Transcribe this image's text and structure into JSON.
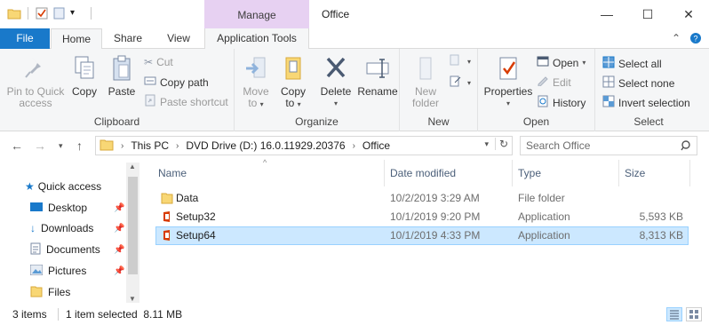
{
  "titlebar": {
    "manage_tab": "Manage",
    "window_title": "Office",
    "minimize": "—",
    "maximize": "☐",
    "close": "✕"
  },
  "tabs": {
    "file": "File",
    "home": "Home",
    "share": "Share",
    "view": "View",
    "application_tools": "Application Tools"
  },
  "ribbon": {
    "clipboard": {
      "label": "Clipboard",
      "pin_to_quick_access_line1": "Pin to Quick",
      "pin_to_quick_access_line2": "access",
      "copy": "Copy",
      "paste": "Paste",
      "cut": "Cut",
      "copy_path": "Copy path",
      "paste_shortcut": "Paste shortcut"
    },
    "organize": {
      "label": "Organize",
      "move_to_line1": "Move",
      "move_to_line2": "to",
      "copy_to_line1": "Copy",
      "copy_to_line2": "to",
      "delete": "Delete",
      "rename": "Rename"
    },
    "new": {
      "label": "New",
      "new_folder_line1": "New",
      "new_folder_line2": "folder"
    },
    "open": {
      "label": "Open",
      "properties": "Properties",
      "open": "Open",
      "edit": "Edit",
      "history": "History"
    },
    "select": {
      "label": "Select",
      "select_all": "Select all",
      "select_none": "Select none",
      "invert_selection": "Invert selection"
    }
  },
  "address": {
    "crumbs": [
      "This PC",
      "DVD Drive (D:) 16.0.11929.20376",
      "Office"
    ],
    "search_placeholder": "Search Office"
  },
  "navpane": {
    "items": [
      {
        "label": "Quick access",
        "icon": "star-icon"
      },
      {
        "label": "Desktop",
        "icon": "desktop-icon"
      },
      {
        "label": "Downloads",
        "icon": "download-icon"
      },
      {
        "label": "Documents",
        "icon": "documents-icon"
      },
      {
        "label": "Pictures",
        "icon": "pictures-icon"
      },
      {
        "label": "Files",
        "icon": "folder-icon"
      }
    ]
  },
  "filelist": {
    "columns": [
      "Name",
      "Date modified",
      "Type",
      "Size"
    ],
    "rows": [
      {
        "name": "Data",
        "date": "10/2/2019 3:29 AM",
        "type": "File folder",
        "size": ""
      },
      {
        "name": "Setup32",
        "date": "10/1/2019 9:20 PM",
        "type": "Application",
        "size": "5,593 KB"
      },
      {
        "name": "Setup64",
        "date": "10/1/2019 4:33 PM",
        "type": "Application",
        "size": "8,313 KB"
      }
    ]
  },
  "statusbar": {
    "items_count": "3 items",
    "selected_info": "1 item selected  8.11 MB"
  },
  "colors": {
    "accent_blue": "#1979ca",
    "manage_purple": "#e7d1f2",
    "selection_bg": "#cce8ff",
    "folder_yellow": "#f8d775",
    "office_red": "#d83b01"
  }
}
